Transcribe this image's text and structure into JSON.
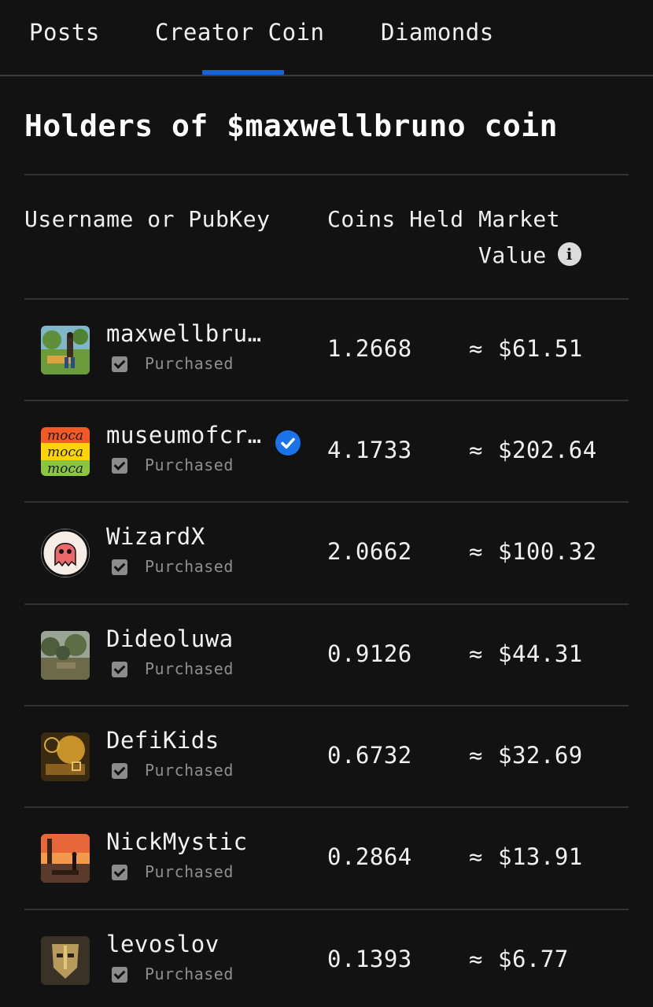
{
  "tabs": [
    {
      "label": "Posts"
    },
    {
      "label": "Creator Coin"
    },
    {
      "label": "Diamonds"
    }
  ],
  "active_tab": "Creator Coin",
  "heading": "Holders of $maxwellbruno coin",
  "columns": {
    "username": "Username or PubKey",
    "coins_held": "Coins Held",
    "market_value_line1": "Market",
    "market_value_line2": "Value",
    "info_icon_glyph": "i"
  },
  "approx_symbol": "≈",
  "colors": {
    "background": "#121212",
    "tab_indicator": "#1565d8",
    "verified_badge": "#1a73e8"
  },
  "holders": [
    {
      "username": "maxwellbru…",
      "verified": false,
      "status": "Purchased",
      "coins": "1.2668",
      "value": "$61.51",
      "avatar": "photo-guitar-icon"
    },
    {
      "username": "museumofcr…",
      "verified": true,
      "status": "Purchased",
      "coins": "4.1733",
      "value": "$202.64",
      "avatar": "moca-logo-icon"
    },
    {
      "username": "WizardX",
      "verified": false,
      "status": "Purchased",
      "coins": "2.0662",
      "value": "$100.32",
      "avatar": "ghost-logo-icon"
    },
    {
      "username": "Dideoluwa",
      "verified": false,
      "status": "Purchased",
      "coins": "0.9126",
      "value": "$44.31",
      "avatar": "photo-landscape-icon"
    },
    {
      "username": "DefiKids",
      "verified": false,
      "status": "Purchased",
      "coins": "0.6732",
      "value": "$32.69",
      "avatar": "gold-artwork-icon"
    },
    {
      "username": "NickMystic",
      "verified": false,
      "status": "Purchased",
      "coins": "0.2864",
      "value": "$13.91",
      "avatar": "sunset-artwork-icon"
    },
    {
      "username": "levoslov",
      "verified": false,
      "status": "Purchased",
      "coins": "0.1393",
      "value": "$6.77",
      "avatar": "mask-portrait-icon"
    }
  ]
}
